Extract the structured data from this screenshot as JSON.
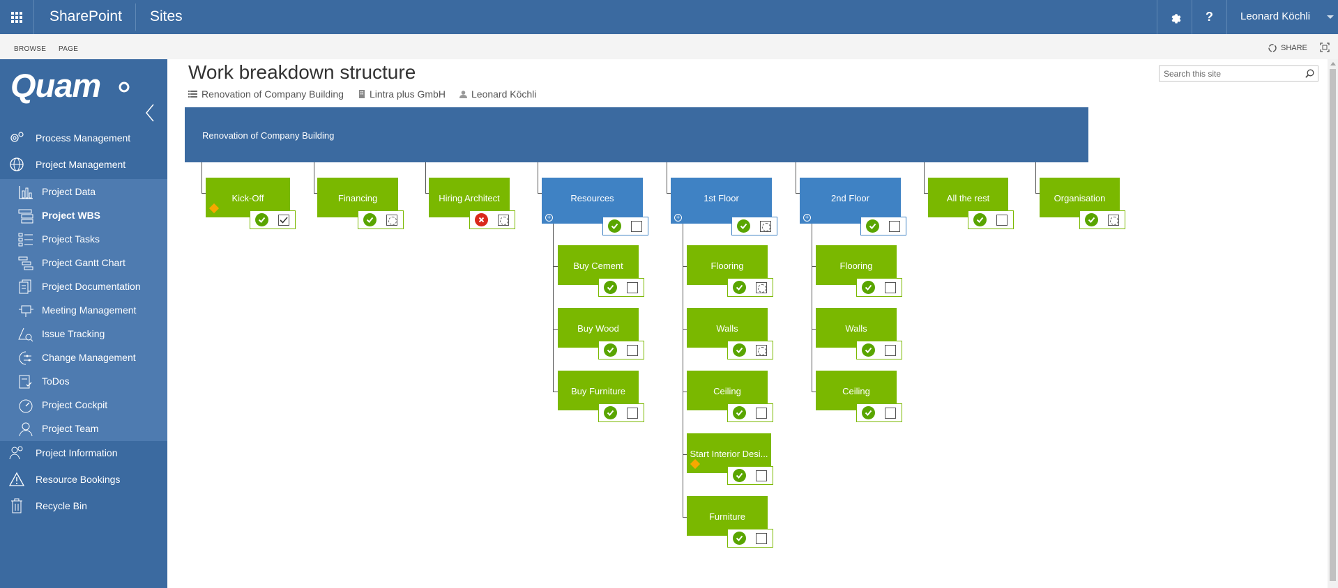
{
  "suite": {
    "brand": "SharePoint",
    "sites": "Sites",
    "user": "Leonard Köchli",
    "help": "?"
  },
  "ribbon": {
    "browse": "BROWSE",
    "page": "PAGE",
    "share": "SHARE"
  },
  "sidebar": {
    "logo": "Quam",
    "items": [
      {
        "label": "Process Management",
        "icon": "gears-icon"
      },
      {
        "label": "Project Management",
        "icon": "globe-icon"
      }
    ],
    "subitems": [
      {
        "label": "Project Data",
        "icon": "chart-icon"
      },
      {
        "label": "Project WBS",
        "icon": "wbs-icon",
        "active": true
      },
      {
        "label": "Project Tasks",
        "icon": "tasks-icon"
      },
      {
        "label": "Project Gantt Chart",
        "icon": "gantt-icon"
      },
      {
        "label": "Project Documentation",
        "icon": "documents-icon"
      },
      {
        "label": "Meeting Management",
        "icon": "meeting-icon"
      },
      {
        "label": "Issue Tracking",
        "icon": "issue-icon"
      },
      {
        "label": "Change Management",
        "icon": "change-icon"
      },
      {
        "label": "ToDos",
        "icon": "todo-icon"
      },
      {
        "label": "Project Cockpit",
        "icon": "cockpit-icon"
      },
      {
        "label": "Project Team",
        "icon": "team-icon"
      }
    ],
    "bottom_items": [
      {
        "label": "Project Information",
        "icon": "people-icon"
      },
      {
        "label": "Resource Bookings",
        "icon": "warning-icon"
      },
      {
        "label": "Recycle Bin",
        "icon": "trash-icon"
      }
    ]
  },
  "main": {
    "title": "Work breakdown structure",
    "meta": {
      "project": "Renovation of Company Building",
      "company": "Lintra plus GmbH",
      "owner": "Leonard Köchli"
    },
    "search_placeholder": "Search this site"
  },
  "wbs": {
    "root": "Renovation of Company Building",
    "level1": [
      {
        "label": "Kick-Off",
        "color": "green",
        "status": "ok",
        "box": "checked",
        "milestone": true
      },
      {
        "label": "Financing",
        "color": "green",
        "status": "ok",
        "box": "dotted"
      },
      {
        "label": "Hiring Architect",
        "color": "green",
        "status": "error",
        "box": "dotted"
      },
      {
        "label": "Resources",
        "color": "blue",
        "status": "ok",
        "box": "empty",
        "expandable": true
      },
      {
        "label": "1st Floor",
        "color": "blue",
        "status": "ok",
        "box": "dotted",
        "expandable": true
      },
      {
        "label": "2nd Floor",
        "color": "blue",
        "status": "ok",
        "box": "empty",
        "expandable": true
      },
      {
        "label": "All the rest",
        "color": "green",
        "status": "ok",
        "box": "empty"
      },
      {
        "label": "Organisation",
        "color": "green",
        "status": "ok",
        "box": "dotted"
      }
    ],
    "resources_children": [
      {
        "label": "Buy Cement",
        "box": "empty"
      },
      {
        "label": "Buy Wood",
        "box": "empty"
      },
      {
        "label": "Buy Furniture",
        "box": "empty"
      }
    ],
    "floor1_children": [
      {
        "label": "Flooring",
        "box": "dotted"
      },
      {
        "label": "Walls",
        "box": "dotted"
      },
      {
        "label": "Ceiling",
        "box": "empty"
      },
      {
        "label": "Start Interior Desi...",
        "box": "empty",
        "milestone": true
      },
      {
        "label": "Furniture",
        "box": "empty"
      }
    ],
    "floor2_children": [
      {
        "label": "Flooring",
        "box": "empty"
      },
      {
        "label": "Walls",
        "box": "empty"
      },
      {
        "label": "Ceiling",
        "box": "empty"
      }
    ],
    "colors": {
      "green": "#7ab800",
      "blue": "#3f82c4",
      "root": "#3b6aa0",
      "ok": "#59a500",
      "error": "#d9291c",
      "milestone": "#f6a800"
    }
  }
}
